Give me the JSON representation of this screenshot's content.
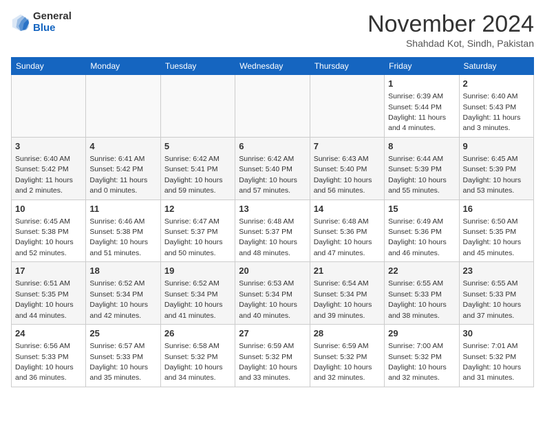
{
  "header": {
    "logo_general": "General",
    "logo_blue": "Blue",
    "month_title": "November 2024",
    "location": "Shahdad Kot, Sindh, Pakistan"
  },
  "weekdays": [
    "Sunday",
    "Monday",
    "Tuesday",
    "Wednesday",
    "Thursday",
    "Friday",
    "Saturday"
  ],
  "weeks": [
    [
      {
        "day": "",
        "info": ""
      },
      {
        "day": "",
        "info": ""
      },
      {
        "day": "",
        "info": ""
      },
      {
        "day": "",
        "info": ""
      },
      {
        "day": "",
        "info": ""
      },
      {
        "day": "1",
        "info": "Sunrise: 6:39 AM\nSunset: 5:44 PM\nDaylight: 11 hours and 4 minutes."
      },
      {
        "day": "2",
        "info": "Sunrise: 6:40 AM\nSunset: 5:43 PM\nDaylight: 11 hours and 3 minutes."
      }
    ],
    [
      {
        "day": "3",
        "info": "Sunrise: 6:40 AM\nSunset: 5:42 PM\nDaylight: 11 hours and 2 minutes."
      },
      {
        "day": "4",
        "info": "Sunrise: 6:41 AM\nSunset: 5:42 PM\nDaylight: 11 hours and 0 minutes."
      },
      {
        "day": "5",
        "info": "Sunrise: 6:42 AM\nSunset: 5:41 PM\nDaylight: 10 hours and 59 minutes."
      },
      {
        "day": "6",
        "info": "Sunrise: 6:42 AM\nSunset: 5:40 PM\nDaylight: 10 hours and 57 minutes."
      },
      {
        "day": "7",
        "info": "Sunrise: 6:43 AM\nSunset: 5:40 PM\nDaylight: 10 hours and 56 minutes."
      },
      {
        "day": "8",
        "info": "Sunrise: 6:44 AM\nSunset: 5:39 PM\nDaylight: 10 hours and 55 minutes."
      },
      {
        "day": "9",
        "info": "Sunrise: 6:45 AM\nSunset: 5:39 PM\nDaylight: 10 hours and 53 minutes."
      }
    ],
    [
      {
        "day": "10",
        "info": "Sunrise: 6:45 AM\nSunset: 5:38 PM\nDaylight: 10 hours and 52 minutes."
      },
      {
        "day": "11",
        "info": "Sunrise: 6:46 AM\nSunset: 5:38 PM\nDaylight: 10 hours and 51 minutes."
      },
      {
        "day": "12",
        "info": "Sunrise: 6:47 AM\nSunset: 5:37 PM\nDaylight: 10 hours and 50 minutes."
      },
      {
        "day": "13",
        "info": "Sunrise: 6:48 AM\nSunset: 5:37 PM\nDaylight: 10 hours and 48 minutes."
      },
      {
        "day": "14",
        "info": "Sunrise: 6:48 AM\nSunset: 5:36 PM\nDaylight: 10 hours and 47 minutes."
      },
      {
        "day": "15",
        "info": "Sunrise: 6:49 AM\nSunset: 5:36 PM\nDaylight: 10 hours and 46 minutes."
      },
      {
        "day": "16",
        "info": "Sunrise: 6:50 AM\nSunset: 5:35 PM\nDaylight: 10 hours and 45 minutes."
      }
    ],
    [
      {
        "day": "17",
        "info": "Sunrise: 6:51 AM\nSunset: 5:35 PM\nDaylight: 10 hours and 44 minutes."
      },
      {
        "day": "18",
        "info": "Sunrise: 6:52 AM\nSunset: 5:34 PM\nDaylight: 10 hours and 42 minutes."
      },
      {
        "day": "19",
        "info": "Sunrise: 6:52 AM\nSunset: 5:34 PM\nDaylight: 10 hours and 41 minutes."
      },
      {
        "day": "20",
        "info": "Sunrise: 6:53 AM\nSunset: 5:34 PM\nDaylight: 10 hours and 40 minutes."
      },
      {
        "day": "21",
        "info": "Sunrise: 6:54 AM\nSunset: 5:34 PM\nDaylight: 10 hours and 39 minutes."
      },
      {
        "day": "22",
        "info": "Sunrise: 6:55 AM\nSunset: 5:33 PM\nDaylight: 10 hours and 38 minutes."
      },
      {
        "day": "23",
        "info": "Sunrise: 6:55 AM\nSunset: 5:33 PM\nDaylight: 10 hours and 37 minutes."
      }
    ],
    [
      {
        "day": "24",
        "info": "Sunrise: 6:56 AM\nSunset: 5:33 PM\nDaylight: 10 hours and 36 minutes."
      },
      {
        "day": "25",
        "info": "Sunrise: 6:57 AM\nSunset: 5:33 PM\nDaylight: 10 hours and 35 minutes."
      },
      {
        "day": "26",
        "info": "Sunrise: 6:58 AM\nSunset: 5:32 PM\nDaylight: 10 hours and 34 minutes."
      },
      {
        "day": "27",
        "info": "Sunrise: 6:59 AM\nSunset: 5:32 PM\nDaylight: 10 hours and 33 minutes."
      },
      {
        "day": "28",
        "info": "Sunrise: 6:59 AM\nSunset: 5:32 PM\nDaylight: 10 hours and 32 minutes."
      },
      {
        "day": "29",
        "info": "Sunrise: 7:00 AM\nSunset: 5:32 PM\nDaylight: 10 hours and 32 minutes."
      },
      {
        "day": "30",
        "info": "Sunrise: 7:01 AM\nSunset: 5:32 PM\nDaylight: 10 hours and 31 minutes."
      }
    ]
  ]
}
